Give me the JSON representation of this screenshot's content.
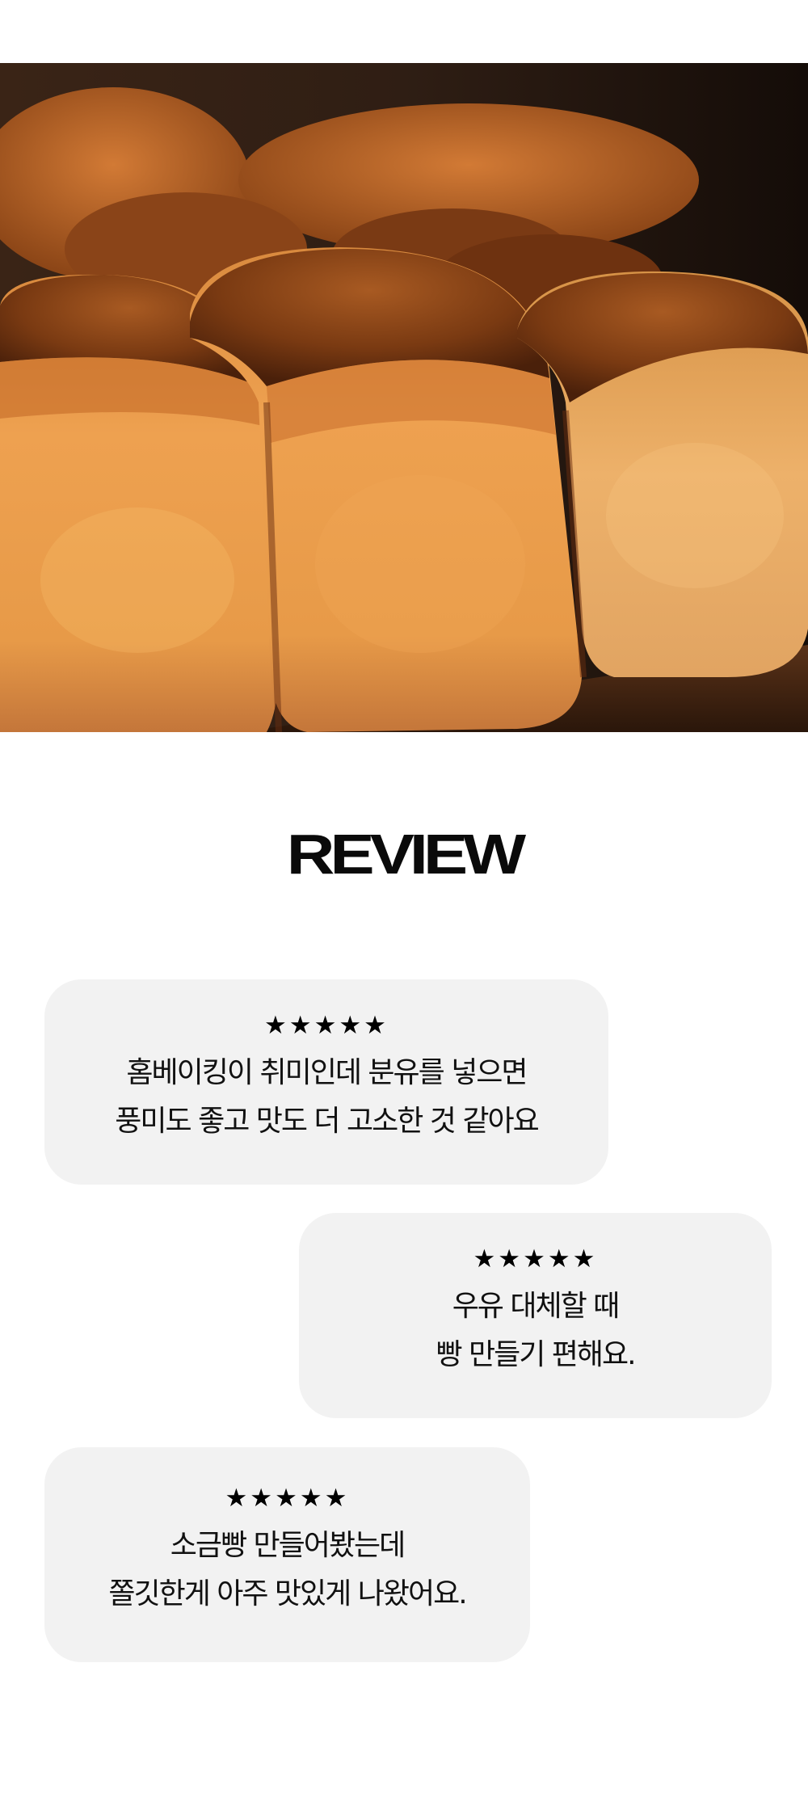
{
  "section_title": "REVIEW",
  "reviews": [
    {
      "stars": "★★★★★",
      "rating": 5,
      "line1": "홈베이킹이 취미인데 분유를 넣으면",
      "line2": "풍미도 좋고 맛도 더 고소한 것 같아요"
    },
    {
      "stars": "★★★★★",
      "rating": 5,
      "line1": "우유 대체할 때",
      "line2": "빵 만들기 편해요."
    },
    {
      "stars": "★★★★★",
      "rating": 5,
      "line1": "소금빵 만들어봤는데",
      "line2": "쫄깃한게 아주 맛있게 나왔어요."
    }
  ],
  "colors": {
    "background": "#ffffff",
    "bubble": "#f2f2f2",
    "text": "#111111"
  }
}
